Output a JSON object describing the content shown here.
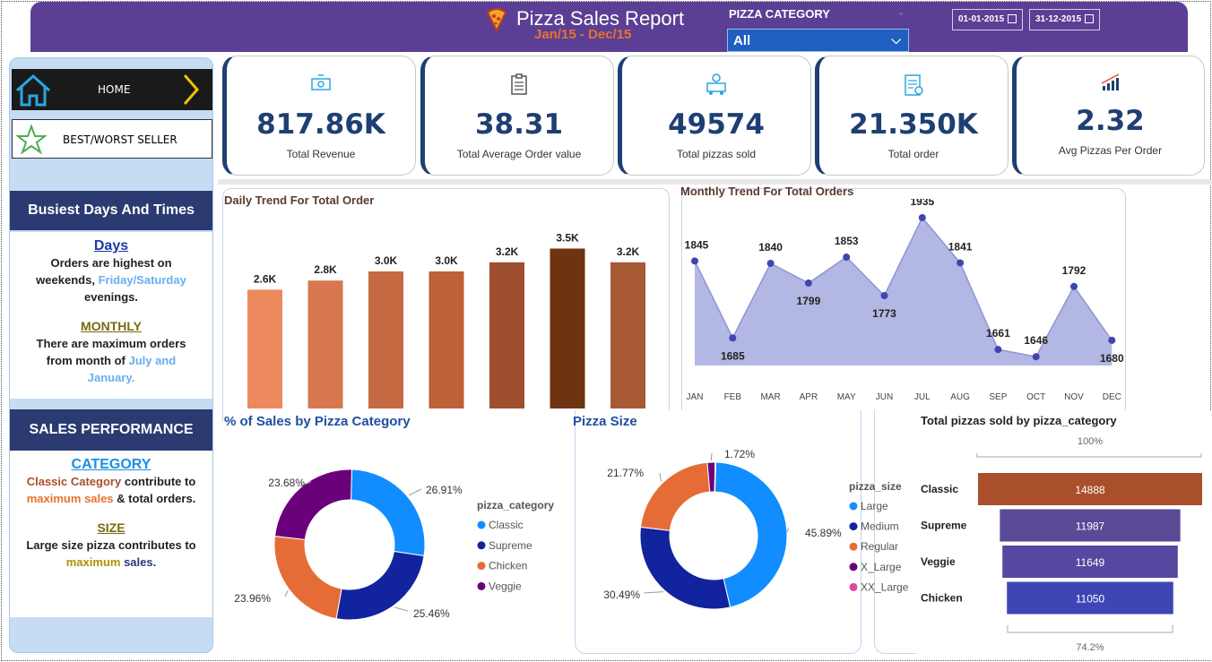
{
  "header": {
    "title": "Pizza Sales Report",
    "subtitle": "Jan/15 - Dec/15",
    "category_label": "PIZZA CATEGORY",
    "category_value": "All",
    "date_from": "01-01-2015",
    "date_to": "31-12-2015"
  },
  "sidebar": {
    "home_label": "HOME",
    "best_label": "BEST/WORST SELLER",
    "busiest_title": "Busiest Days And Times",
    "days_heading": "Days",
    "days_text_1": "Orders are highest on",
    "days_text_2": "weekends,",
    "days_highlight": "Friday/Saturday",
    "days_text_3": "evenings.",
    "monthly_heading": "MONTHLY",
    "monthly_text_1": "There are maximum orders",
    "monthly_text_2": "from month of",
    "monthly_highlight_1": "July and",
    "monthly_highlight_2": "January.",
    "sales_title": "SALES PERFORMANCE",
    "category_heading": "CATEGORY",
    "category_hl_1": "Classic Category",
    "category_text_1": "contribute to",
    "category_hl_2": "maximum sales",
    "category_text_2": "& total orders.",
    "size_heading": "SIZE",
    "size_text_1": "Large size pizza contributes to",
    "size_hl_1": "maximum",
    "size_hl_2": "sales."
  },
  "kpis": [
    {
      "value": "817.86K",
      "label": "Total Revenue",
      "icon": "money-icon"
    },
    {
      "value": "38.31",
      "label": "Total Average Order value",
      "icon": "clipboard-icon"
    },
    {
      "value": "49574",
      "label": "Total pizzas sold",
      "icon": "delivery-icon"
    },
    {
      "value": "21.350K",
      "label": "Total order",
      "icon": "order-list-icon"
    },
    {
      "value": "2.32",
      "label": "Avg Pizzas Per Order",
      "icon": "growth-chart-icon"
    }
  ],
  "colors": {
    "header": "#5b3f95",
    "navy": "#1f3f73",
    "area": "#b3b7e3",
    "classic": "#118dff",
    "supreme": "#12239e",
    "chicken": "#e66c37",
    "veggie": "#6b007b"
  },
  "chart_data": [
    {
      "type": "bar",
      "title": "Daily Trend For Total Order",
      "values": [
        2.6,
        2.8,
        3.0,
        3.0,
        3.2,
        3.5,
        3.2
      ],
      "data_labels": [
        "2.6K",
        "2.8K",
        "3.0K",
        "3.0K",
        "3.2K",
        "3.5K",
        "3.2K"
      ],
      "colors": [
        "#ec8a5e",
        "#d77750",
        "#c56a42",
        "#bd6138",
        "#9e4f2d",
        "#6e3311",
        "#a85a34"
      ]
    },
    {
      "type": "area",
      "title": "Monthly Trend For Total Orders",
      "categories": [
        "JAN",
        "FEB",
        "MAR",
        "APR",
        "MAY",
        "JUN",
        "JUL",
        "AUG",
        "SEP",
        "OCT",
        "NOV",
        "DEC"
      ],
      "values": [
        1845,
        1685,
        1840,
        1799,
        1853,
        1773,
        1935,
        1841,
        1661,
        1646,
        1792,
        1680
      ]
    },
    {
      "type": "pie",
      "title": "% of Sales by Pizza Category",
      "legend_title": "pizza_category",
      "labels": [
        "Classic",
        "Supreme",
        "Chicken",
        "Veggie"
      ],
      "values": [
        26.91,
        25.46,
        23.96,
        23.68
      ],
      "value_labels": [
        "26.91%",
        "25.46%",
        "23.96%",
        "23.68%"
      ],
      "colors": [
        "#118dff",
        "#12239e",
        "#e66c37",
        "#6b007b"
      ]
    },
    {
      "type": "pie",
      "title": "Pizza Size",
      "legend_title": "pizza_size",
      "labels": [
        "Large",
        "Medium",
        "Regular",
        "X_Large",
        "XX_Large"
      ],
      "values": [
        45.89,
        30.49,
        21.77,
        1.72,
        0.12
      ],
      "value_labels": [
        "45.89%",
        "30.49%",
        "21.77%",
        "1.72%",
        ""
      ],
      "colors": [
        "#118dff",
        "#12239e",
        "#e66c37",
        "#6b007b",
        "#e044a7"
      ]
    },
    {
      "type": "bar",
      "title": "Total pizzas sold by pizza_category",
      "categories": [
        "Classic",
        "Supreme",
        "Veggie",
        "Chicken"
      ],
      "values": [
        14888,
        11987,
        11649,
        11050
      ],
      "top_label": "100%",
      "bottom_label": "74.2%",
      "colors": [
        "#a94f2b",
        "#5a4a95",
        "#5648a0",
        "#3d46b4"
      ]
    }
  ]
}
